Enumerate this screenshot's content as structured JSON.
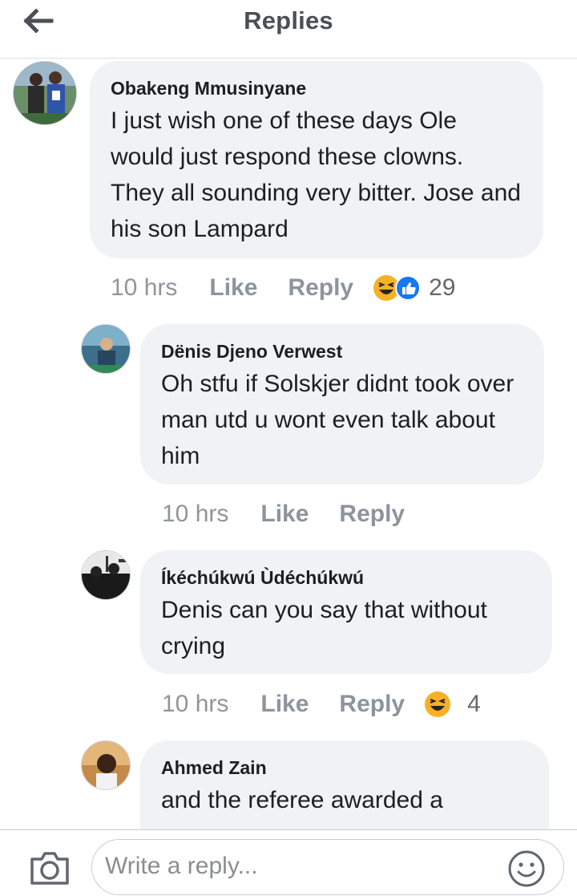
{
  "header": {
    "title": "Replies",
    "back_icon": "arrow-left-icon"
  },
  "comments": [
    {
      "author": "Obakeng Mmusinyane",
      "text": "I just wish one of these days Ole would just respond these clowns. They all sounding very bitter. Jose and his son Lampard",
      "time": "10 hrs",
      "like": "Like",
      "reply": "Reply",
      "reactions": [
        "laughing-emoji",
        "like-thumb"
      ],
      "reaction_count": "29"
    },
    {
      "author": "Dënis Djeno Verwest",
      "text": "Oh stfu if Solskjer didnt took over man utd u wont even talk about him",
      "time": "10 hrs",
      "like": "Like",
      "reply": "Reply"
    },
    {
      "author": "Íkéchúkwú Ùdéchúkwú",
      "text": "Denis can you say that without crying",
      "time": "10 hrs",
      "like": "Like",
      "reply": "Reply",
      "reactions": [
        "laughing-emoji"
      ],
      "reaction_count": "4"
    },
    {
      "author": "Ahmed Zain",
      "text": "and the referee awarded a"
    }
  ],
  "composer": {
    "placeholder": "Write a reply...",
    "camera_icon": "camera-icon",
    "emoji_icon": "smiley-icon"
  },
  "colors": {
    "bubble": "#f0f2f5",
    "like_blue": "#1877f2",
    "laugh_yellow": "#f7b125",
    "meta_gray": "#90949c"
  }
}
